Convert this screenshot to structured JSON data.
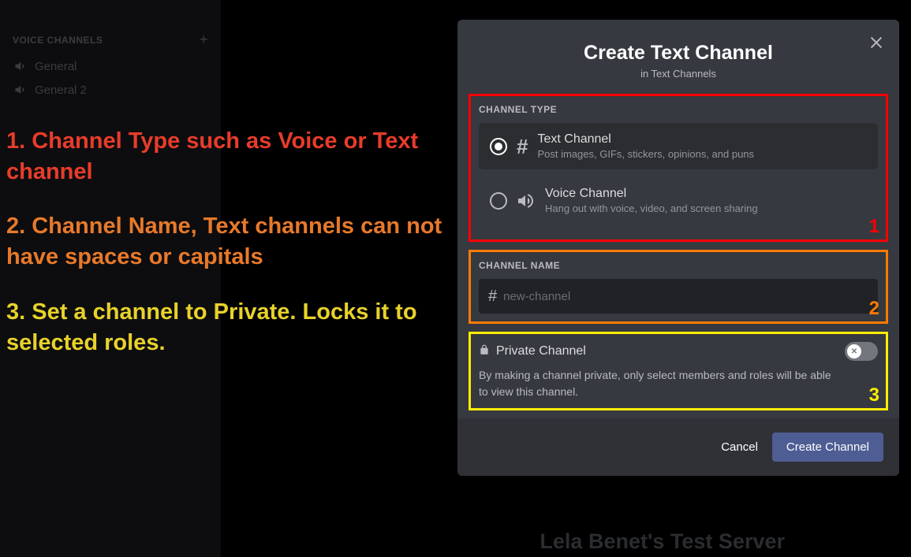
{
  "sidebar": {
    "voice_header": "VOICE CHANNELS",
    "channels": [
      "General",
      "General 2"
    ]
  },
  "annotations": {
    "a1": "1. Channel Type such as Voice or Text channel",
    "a2": "2. Channel Name, Text channels can not have spaces or capitals",
    "a3": "3. Set a channel to Private. Locks it to selected roles."
  },
  "modal": {
    "title": "Create Text Channel",
    "subtitle": "in Text Channels",
    "channel_type_label": "CHANNEL TYPE",
    "text_option": {
      "title": "Text Channel",
      "desc": "Post images, GIFs, stickers, opinions, and puns"
    },
    "voice_option": {
      "title": "Voice Channel",
      "desc": "Hang out with voice, video, and screen sharing"
    },
    "channel_name_label": "CHANNEL NAME",
    "name_placeholder": "new-channel",
    "private": {
      "title": "Private Channel",
      "desc": "By making a channel private, only select members and roles will be able to view this channel."
    },
    "cancel": "Cancel",
    "create": "Create Channel"
  },
  "box_numbers": {
    "b1": "1",
    "b2": "2",
    "b3": "3"
  },
  "watermark": "Lela Benet's Test Server"
}
